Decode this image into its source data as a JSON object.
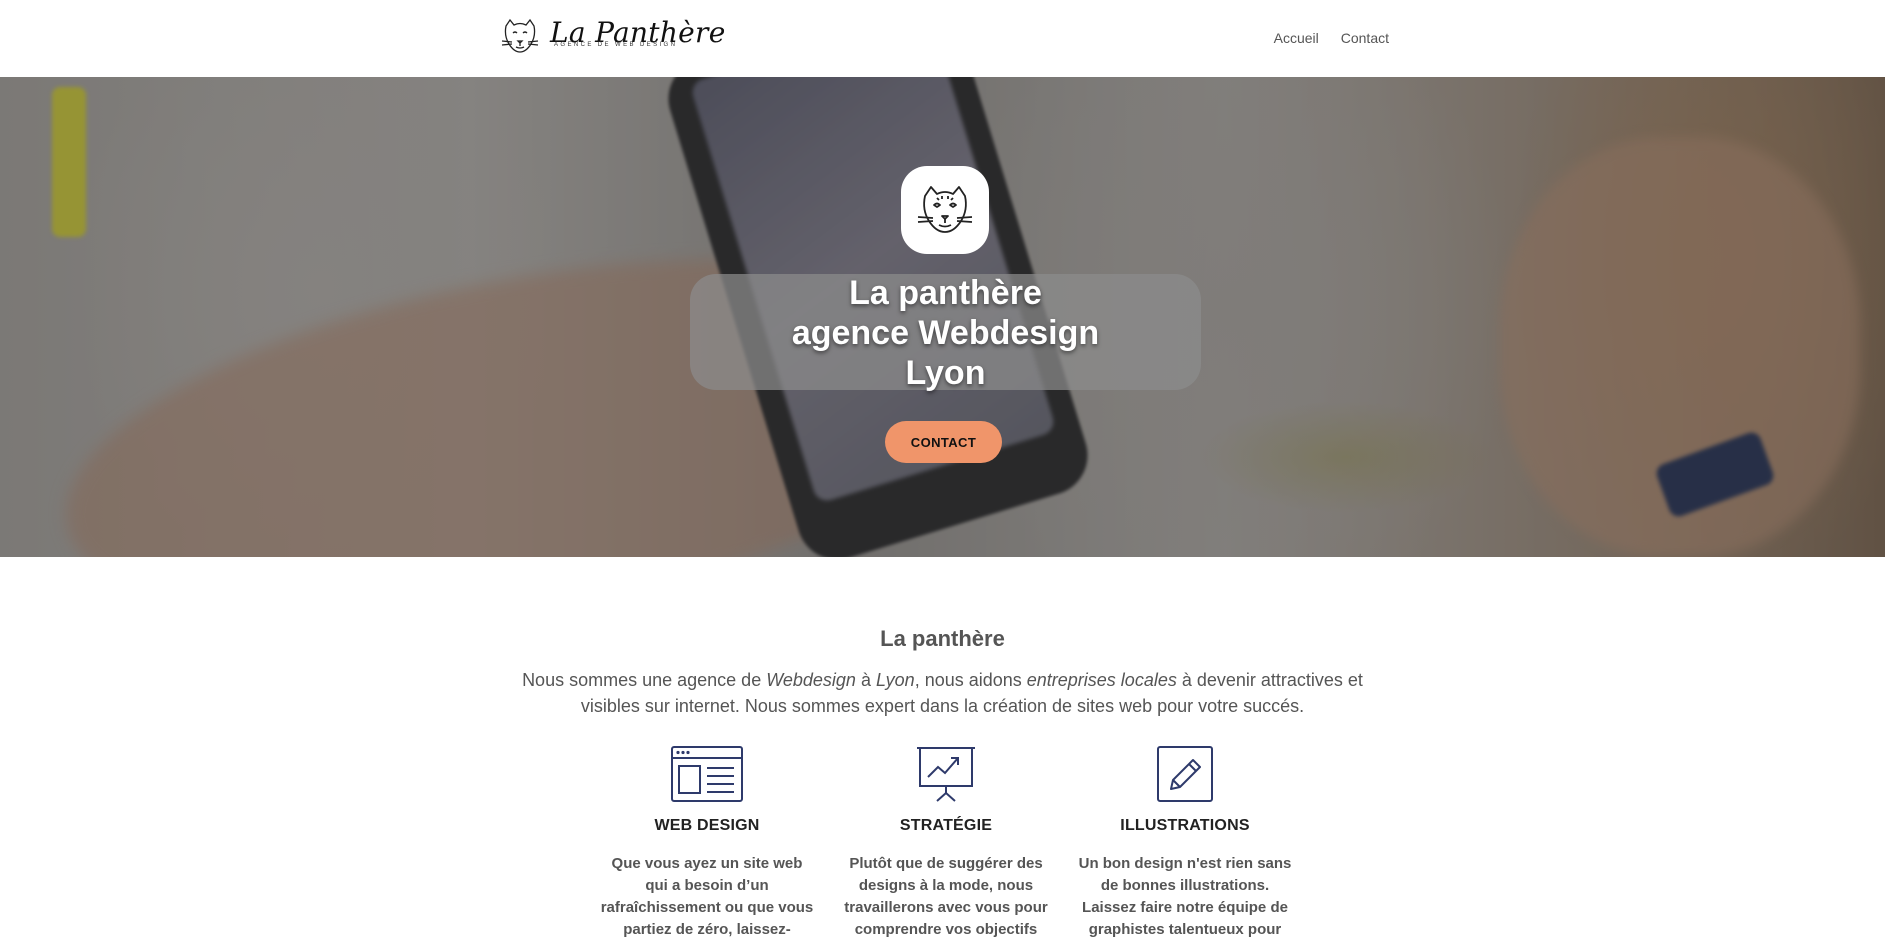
{
  "header": {
    "logo_title": "La Panthère",
    "logo_subtitle": "Agence de web design",
    "nav": [
      "Accueil",
      "Contact"
    ]
  },
  "hero": {
    "title_lines": [
      "La panthère",
      "agence Webdesign",
      "Lyon"
    ],
    "cta_label": "CONTACT",
    "cta_color": "#f0956a"
  },
  "about": {
    "title": "La panthère",
    "text_parts": [
      "Nous sommes une agence de ",
      "Webdesign",
      " à ",
      "Lyon",
      ", nous aidons ",
      "entreprises locales",
      " à devenir attractives et visibles sur internet. Nous sommes expert dans la création de sites web pour votre succés."
    ]
  },
  "services": [
    {
      "icon": "browser-layout-icon",
      "title": "WEB DESIGN",
      "text": "Que vous ayez un site web qui a besoin d’un rafraîchissement ou que vous partiez de zéro, laissez-"
    },
    {
      "icon": "presentation-chart-icon",
      "title": "STRATÉGIE",
      "text": "Plutôt que de suggérer des designs à la mode, nous travaillerons avec vous pour comprendre vos objectifs"
    },
    {
      "icon": "pencil-edit-icon",
      "title": "ILLUSTRATIONS",
      "text": "Un bon design n'est rien sans de bonnes illustrations. Laissez faire notre équipe de graphistes talentueux pour"
    }
  ],
  "colors": {
    "icon_stroke": "#2e3a6b",
    "accent": "#f0956a"
  }
}
